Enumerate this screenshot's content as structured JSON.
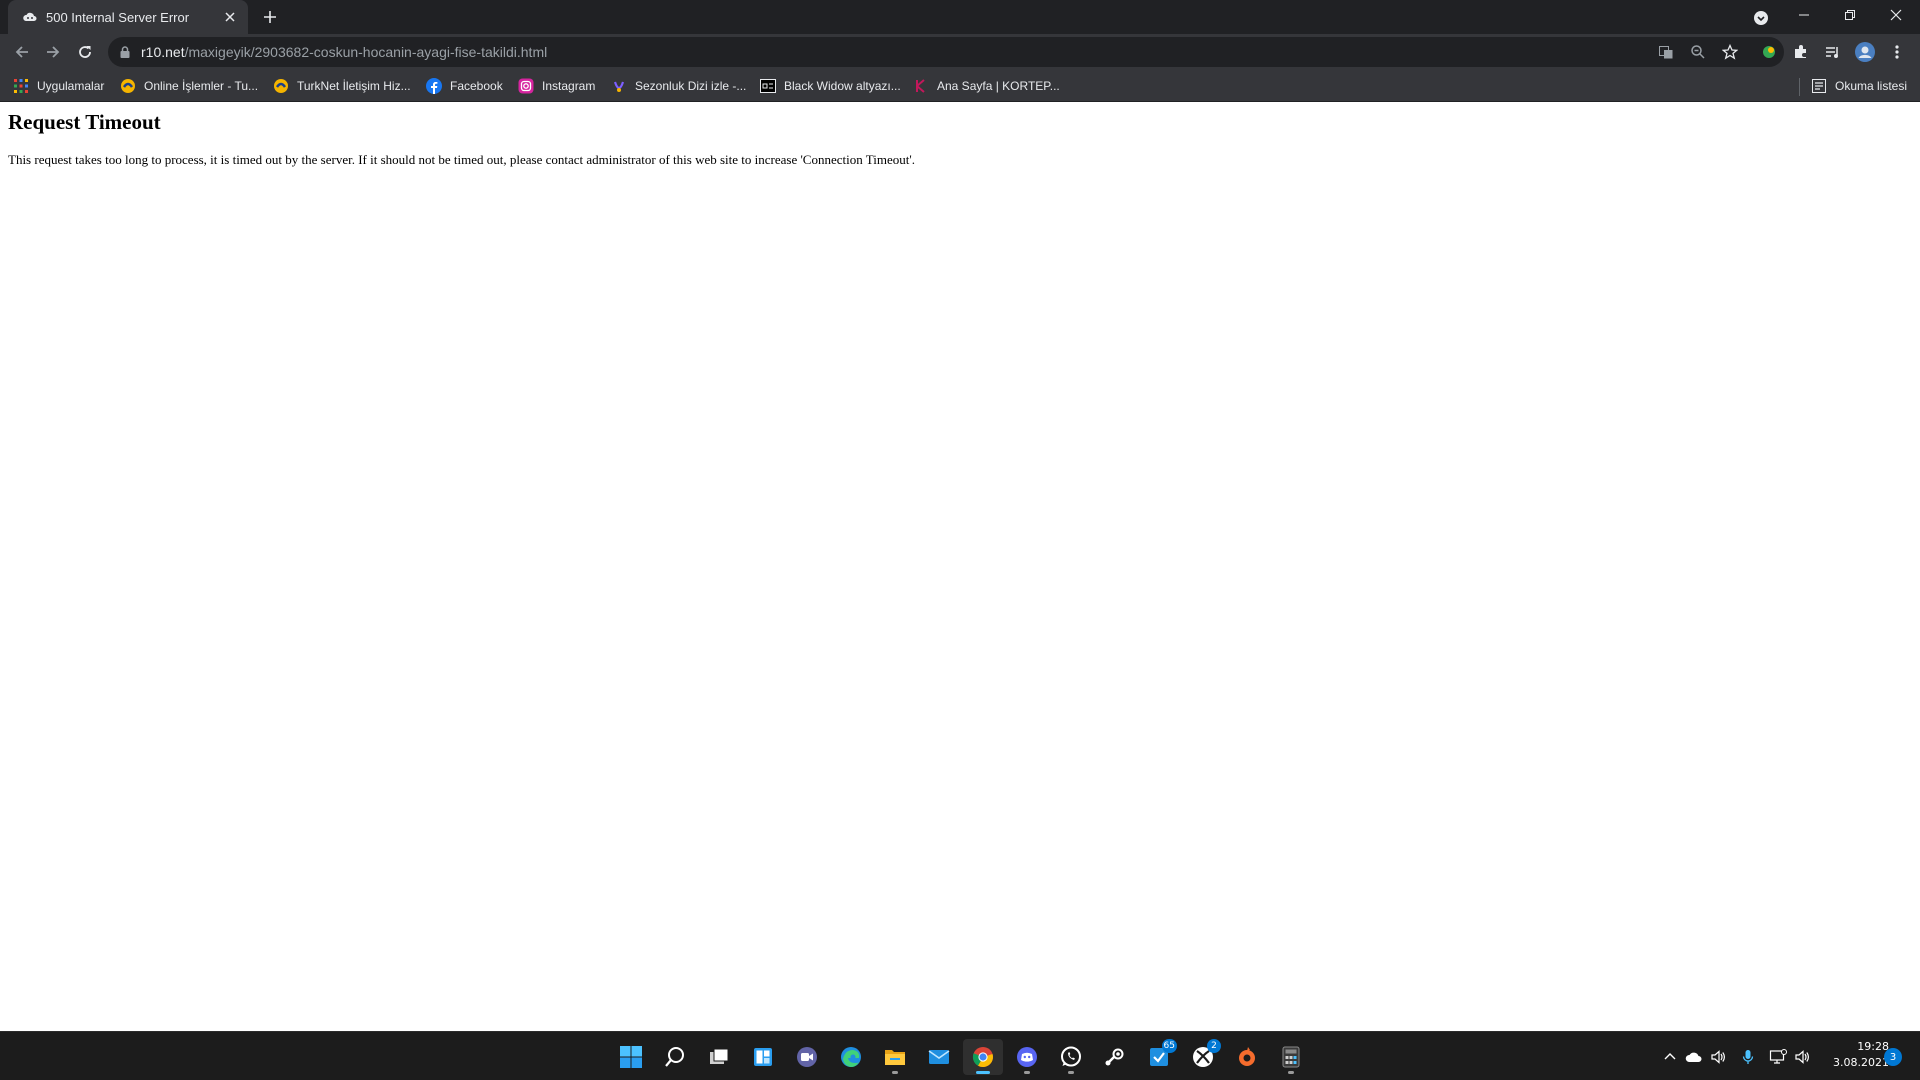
{
  "browser": {
    "tab": {
      "title": "500 Internal Server Error",
      "favicon": "cloud-favicon-icon"
    },
    "address": {
      "host": "r10.net",
      "path": "/maxigeyik/2903682-coskun-hocanin-ayagi-fise-takildi.html"
    },
    "bookmarks": [
      {
        "label": "Uygulamalar",
        "icon": "apps-grid-icon"
      },
      {
        "label": "Online İşlemler - Tu...",
        "icon": "turknet-icon"
      },
      {
        "label": "TurkNet İletişim Hiz...",
        "icon": "turknet-icon"
      },
      {
        "label": "Facebook",
        "icon": "facebook-icon"
      },
      {
        "label": "Instagram",
        "icon": "instagram-icon"
      },
      {
        "label": "Sezonluk Dizi izle -...",
        "icon": "sezonluk-icon"
      },
      {
        "label": "Black Widow altyazı...",
        "icon": "subtitle-site-icon"
      },
      {
        "label": "Ana Sayfa | KORTEP...",
        "icon": "kortep-icon"
      }
    ],
    "reading_list": "Okuma listesi"
  },
  "page": {
    "heading": "Request Timeout",
    "message": "This request takes too long to process, it is timed out by the server. If it should not be timed out, please contact administrator of this web site to increase 'Connection Timeout'."
  },
  "taskbar": {
    "apps": [
      "start",
      "search",
      "task-view",
      "widgets",
      "teams-chat",
      "edge",
      "file-explorer",
      "mail",
      "chrome",
      "discord",
      "whatsapp",
      "steam",
      "todo",
      "xbox",
      "origin",
      "calculator"
    ],
    "badges": {
      "todo": "65",
      "xbox": "2"
    },
    "time": "19:28",
    "date": "3.08.2021",
    "notification_count": "3"
  },
  "colors": {
    "tabstrip": "#202124",
    "toolbar": "#35363a",
    "taskbar": "#1c1c1c",
    "accent": "#0078d4"
  }
}
